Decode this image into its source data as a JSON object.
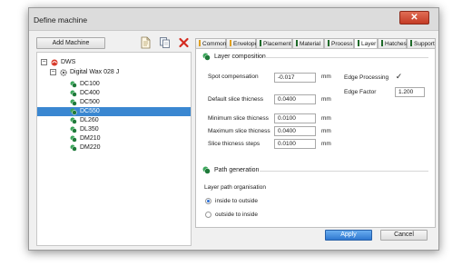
{
  "window": {
    "title": "Define machine",
    "close_symbol": "✕"
  },
  "toolbar": {
    "add_machine_label": "Add Machine",
    "icons": [
      "new-document-icon",
      "copy-icon",
      "delete-icon"
    ]
  },
  "tree": {
    "root": {
      "label": "DWS",
      "expander": "−",
      "icon": "dws-logo-icon"
    },
    "machine": {
      "label": "Digital Wax 028 J",
      "expander": "−",
      "icon": "gear-icon"
    },
    "items": [
      {
        "label": "DC100"
      },
      {
        "label": "DC400"
      },
      {
        "label": "DC500"
      },
      {
        "label": "DC550",
        "selected": true
      },
      {
        "label": "DL260"
      },
      {
        "label": "DL350"
      },
      {
        "label": "DM210"
      },
      {
        "label": "DM220"
      }
    ]
  },
  "tabs": [
    {
      "label": "Common",
      "color": "#e0a020"
    },
    {
      "label": "Envelope",
      "color": "#e0a020"
    },
    {
      "label": "Placement",
      "color": "#1f6b2a"
    },
    {
      "label": "Material",
      "color": "#1f6b2a"
    },
    {
      "label": "Process",
      "color": "#1f6b2a"
    },
    {
      "label": "Layer",
      "color": "#1f6b2a",
      "active": true
    },
    {
      "label": "Hatches",
      "color": "#1f6b2a"
    },
    {
      "label": "Support",
      "color": "#1f6b2a"
    }
  ],
  "layer_composition": {
    "title": "Layer composition",
    "spot_compensation": {
      "label": "Spot compensation",
      "value": "-0.017",
      "unit": "mm"
    },
    "default_slice_thickness": {
      "label": "Default slice thicness",
      "value": "0.0400",
      "unit": "mm"
    },
    "minimum_slice_thickness": {
      "label": "Minimum slice thicness",
      "value": "0.0100",
      "unit": "mm"
    },
    "maximum_slice_thickness": {
      "label": "Maximum slice thicness",
      "value": "0.0400",
      "unit": "mm"
    },
    "slice_thickness_steps": {
      "label": "Slice thicness steps",
      "value": "0.0100",
      "unit": "mm"
    },
    "edge_processing": {
      "label": "Edge Processing",
      "checked": true,
      "check_symbol": "✓"
    },
    "edge_factor": {
      "label": "Edge Factor",
      "value": "1.200"
    }
  },
  "path_generation": {
    "title": "Path generation",
    "organisation_label": "Layer path organisation",
    "options": [
      {
        "label": "inside to outside",
        "selected": true
      },
      {
        "label": "outside to inside",
        "selected": false
      }
    ]
  },
  "footer": {
    "apply_label": "Apply",
    "cancel_label": "Cancel"
  },
  "colors": {
    "accent": "#3a87d1",
    "close": "#c9442e",
    "apply": "#3f86d9"
  }
}
